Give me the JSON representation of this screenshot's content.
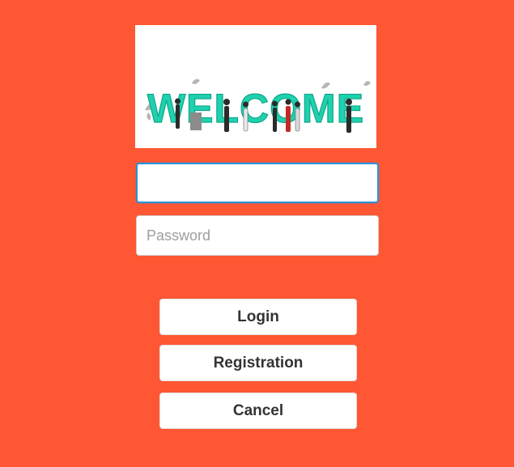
{
  "banner": {
    "text": "WELCOME"
  },
  "form": {
    "username": {
      "value": "",
      "placeholder": ""
    },
    "password": {
      "value": "",
      "placeholder": "Password"
    }
  },
  "buttons": {
    "login": "Login",
    "registration": "Registration",
    "cancel": "Cancel"
  },
  "colors": {
    "background": "#FF5733",
    "banner_letters": "#1FD1AE",
    "button_text": "#333333",
    "focus_border": "#2D8FD8"
  }
}
